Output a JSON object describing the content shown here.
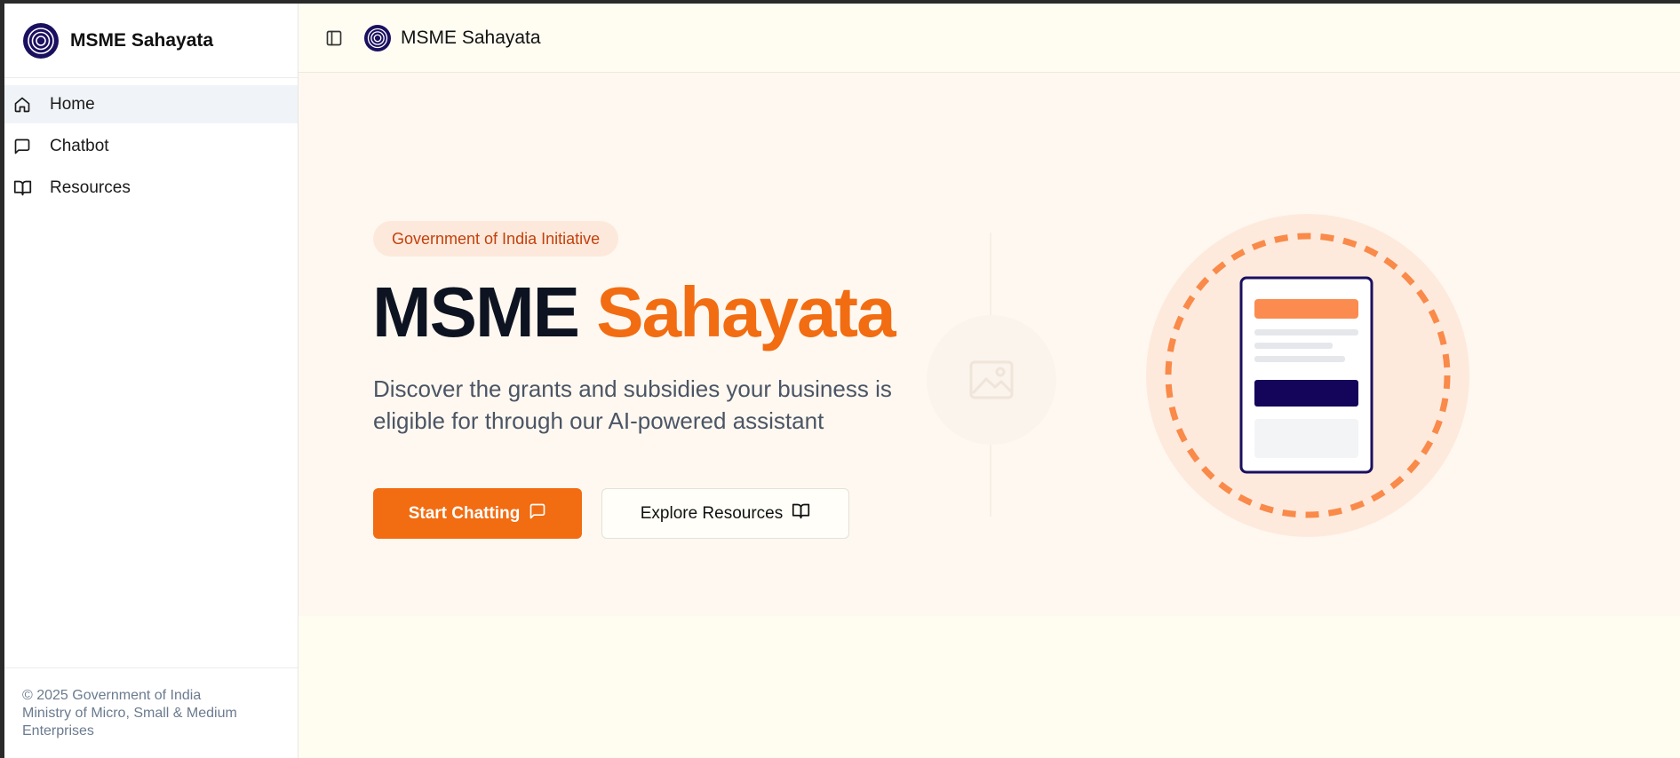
{
  "sidebar": {
    "brand": "MSME Sahayata",
    "items": [
      {
        "label": "Home",
        "icon": "home-icon",
        "active": true
      },
      {
        "label": "Chatbot",
        "icon": "message-square-icon",
        "active": false
      },
      {
        "label": "Resources",
        "icon": "book-open-icon",
        "active": false
      }
    ],
    "footer_line1": "© 2025 Government of India",
    "footer_line2": "Ministry of Micro, Small & Medium Enterprises"
  },
  "topbar": {
    "title": "MSME Sahayata",
    "toggle_icon": "sidebar-toggle-icon"
  },
  "hero": {
    "badge": "Government of India Initiative",
    "title_part1": "MSME",
    "title_part2": "Sahayata",
    "subtitle": "Discover the grants and subsidies your business is eligible for through our AI-powered assistant",
    "primary_button": "Start Chatting",
    "secondary_button": "Explore Resources"
  },
  "colors": {
    "accent": "#f26c12",
    "navy": "#1a1060",
    "background": "#fef8f0"
  }
}
